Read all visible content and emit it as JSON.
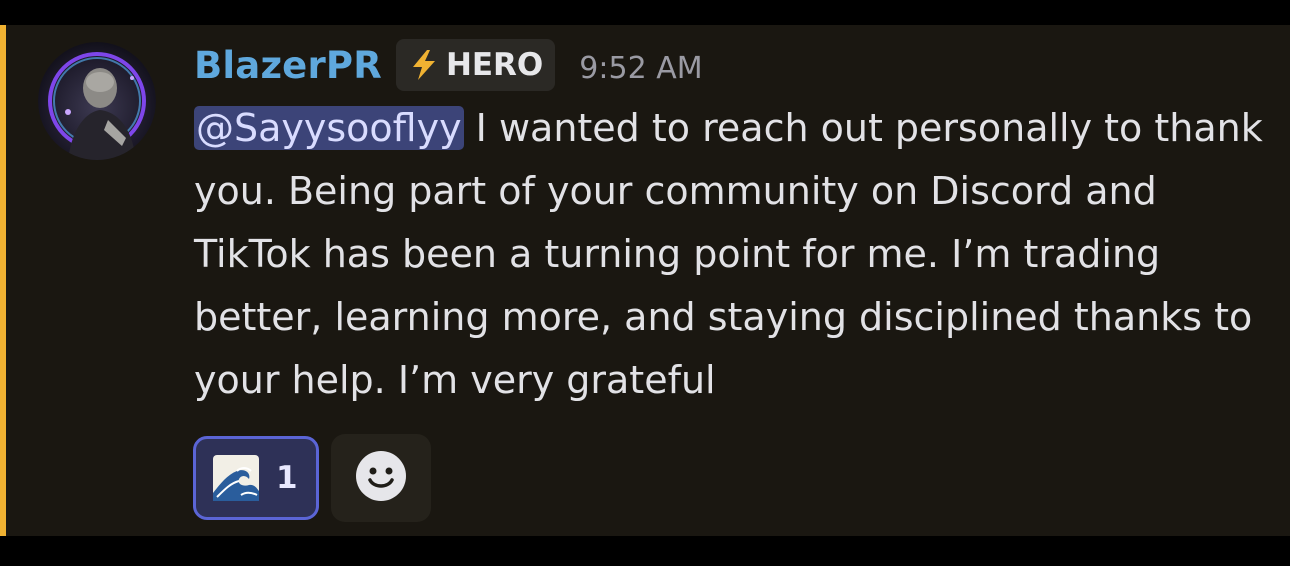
{
  "message": {
    "author": "BlazerPR",
    "author_color": "#5fa8dd",
    "tag": {
      "icon": "lightning-bolt-icon",
      "label": "HERO"
    },
    "timestamp": "9:52 AM",
    "mention": "@Sayysooflyy",
    "text": " I wanted to reach out personally to thank you. Being part of your community on Discord and TikTok has been a turning point for me. I’m trading better, learning more, and staying disciplined thanks to your help. I’m very grateful",
    "highlight_color": "#f0b232"
  },
  "reactions": [
    {
      "emoji": "wave-emoji",
      "count": "1",
      "selected": true
    }
  ],
  "add_reaction": {
    "icon": "smiley-face-icon"
  }
}
